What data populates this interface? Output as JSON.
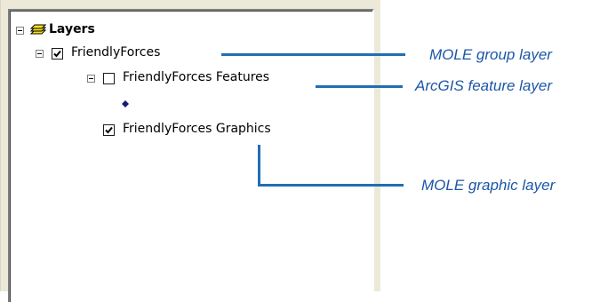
{
  "toc": {
    "root": {
      "label": "Layers",
      "icon": "layers-stack-icon"
    },
    "group_layer": {
      "label": "FriendlyForces",
      "checked": true
    },
    "feature_layer": {
      "label": "FriendlyForces Features",
      "checked": false,
      "symbol": "point-symbol-icon"
    },
    "graphic_layer": {
      "label": "FriendlyForces Graphics",
      "checked": true
    }
  },
  "annotations": {
    "group": "MOLE group layer",
    "feature": "ArcGIS feature layer",
    "graphic": "MOLE graphic layer"
  },
  "colors": {
    "annotation_text": "#1b57a6",
    "leader_line": "#1f6fb4",
    "symbol_dot": "#1a1a6e"
  }
}
